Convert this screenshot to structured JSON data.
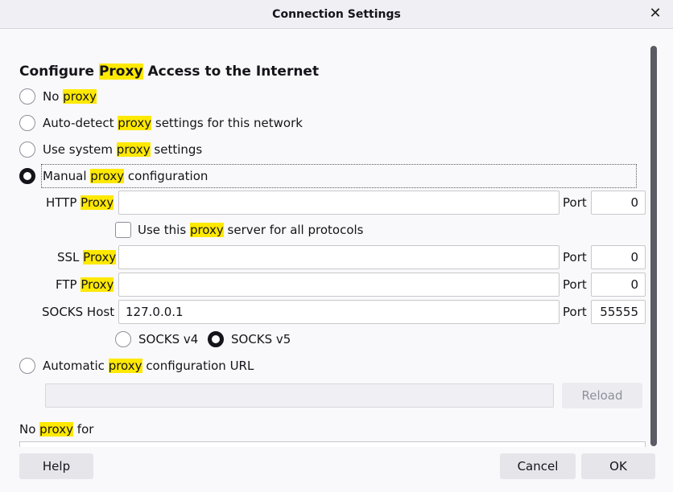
{
  "window": {
    "title": "Connection Settings",
    "close_icon": "close-icon"
  },
  "heading": {
    "pre": "Configure ",
    "hl": "Proxy",
    "post": " Access to the Internet"
  },
  "options": {
    "no_proxy": {
      "pre": "No ",
      "hl": "proxy",
      "post": ""
    },
    "auto_detect": {
      "pre": "Auto-detect ",
      "hl": "proxy",
      "post": " settings for this network"
    },
    "system": {
      "pre": "Use system ",
      "hl": "proxy",
      "post": " settings"
    },
    "manual": {
      "pre": "Manual ",
      "hl": "proxy",
      "post": " configuration",
      "checked": true
    },
    "auto_url": {
      "pre": "Automatic ",
      "hl": "proxy",
      "post": " configuration URL"
    }
  },
  "http": {
    "pre": "HTTP ",
    "hl": "Proxy",
    "value": "",
    "port_label": "Port",
    "port": "0"
  },
  "use_for_all": {
    "pre": "Use this ",
    "hl": "proxy",
    "post": " server for all protocols",
    "checked": false
  },
  "ssl": {
    "pre": "SSL ",
    "hl": "Proxy",
    "value": "",
    "port_label": "Port",
    "port": "0"
  },
  "ftp": {
    "pre": "FTP ",
    "hl": "Proxy",
    "value": "",
    "port_label": "Port",
    "port": "0"
  },
  "socks": {
    "label": "SOCKS Host",
    "value": "127.0.0.1",
    "port_label": "Port",
    "port": "55555",
    "v4": "SOCKS v4",
    "v5": "SOCKS v5",
    "selected": "v5"
  },
  "auto_url_field": {
    "value": "",
    "reload": "Reload"
  },
  "no_proxy_for": {
    "pre": "No ",
    "hl": "proxy",
    "post": " for"
  },
  "footer": {
    "help": "Help",
    "cancel": "Cancel",
    "ok": "OK"
  },
  "colors": {
    "highlight": "#ffe900",
    "accent": "#15141a"
  }
}
